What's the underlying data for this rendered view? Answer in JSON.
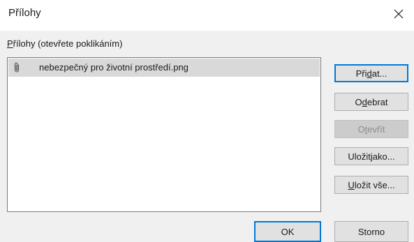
{
  "dialog": {
    "title": "Přílohy",
    "list_label_prefix": "P",
    "list_label_rest": "řílohy (otevřete poklikáním)"
  },
  "attachments": [
    {
      "name": "nebezpečný pro životní prostředí.png",
      "icon": "paperclip-icon"
    }
  ],
  "buttons": {
    "add": {
      "before": "Při",
      "mnemonic": "d",
      "after": "at..."
    },
    "remove": {
      "before": "O",
      "mnemonic": "d",
      "after": "ebrat"
    },
    "open": {
      "before": "O",
      "mnemonic": "t",
      "after": "evřít"
    },
    "save_as": {
      "before": "Uložit ",
      "mnemonic": "j",
      "after": "ako..."
    },
    "save_all": {
      "before": "",
      "mnemonic": "U",
      "after": "ložit vše..."
    },
    "ok": "OK",
    "cancel": "Storno"
  },
  "colors": {
    "accent": "#0078d7",
    "selection": "#d9d9d9",
    "dialog_bg": "#f0f0f0"
  }
}
